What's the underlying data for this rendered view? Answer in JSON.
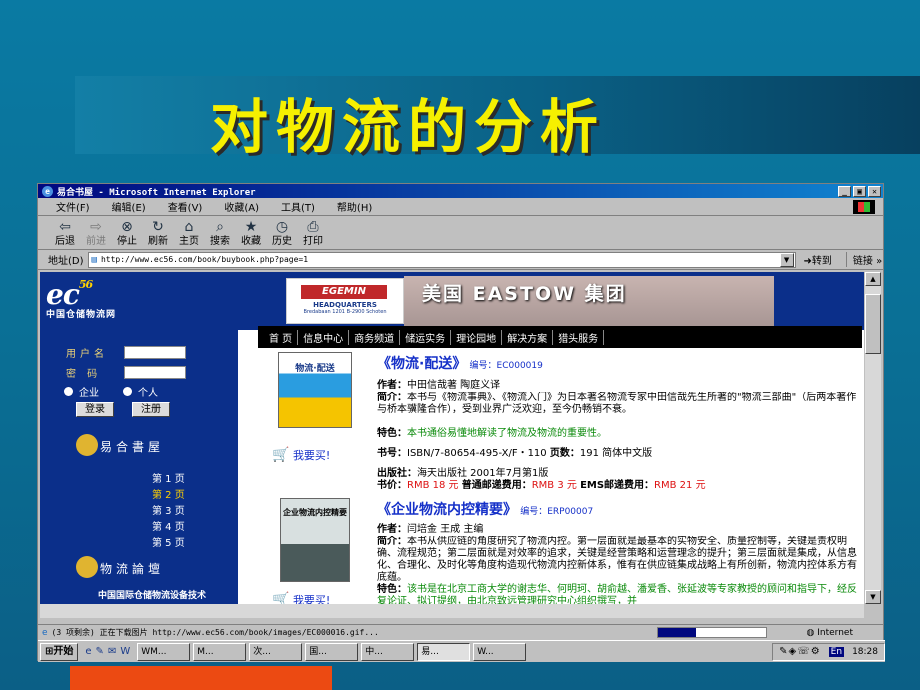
{
  "slide": {
    "title": "对物流的分析"
  },
  "browser": {
    "window_title": "易合书屋 - Microsoft Internet Explorer",
    "menu": [
      "文件(F)",
      "编辑(E)",
      "查看(V)",
      "收藏(A)",
      "工具(T)",
      "帮助(H)"
    ],
    "toolbar": [
      {
        "label": "后退",
        "icon": "back-arrow-icon",
        "enabled": true
      },
      {
        "label": "前进",
        "icon": "forward-arrow-icon",
        "enabled": false
      },
      {
        "label": "停止",
        "icon": "stop-icon",
        "enabled": true
      },
      {
        "label": "刷新",
        "icon": "refresh-icon",
        "enabled": true
      },
      {
        "label": "主页",
        "icon": "home-icon",
        "enabled": true
      },
      {
        "label": "搜索",
        "icon": "search-icon",
        "enabled": true
      },
      {
        "label": "收藏",
        "icon": "favorites-icon",
        "enabled": true
      },
      {
        "label": "历史",
        "icon": "history-icon",
        "enabled": true
      },
      {
        "label": "打印",
        "icon": "print-icon",
        "enabled": true
      }
    ],
    "address_label": "地址(D)",
    "url": "http://www.ec56.com/book/buybook.php?page=1",
    "go_label": "转到",
    "links_label": "链接",
    "status_text": "(3 项剩余) 正在下载图片 http://www.ec56.com/book/images/EC000016.gif...",
    "zone": "Internet"
  },
  "site": {
    "logo_text": "ec",
    "logo_num": "56",
    "logo_sub": "中国仓储物流网",
    "banner_company": "EGEMIN",
    "banner_hq": "HEADQUARTERS",
    "banner_addr": "Bredabaan 1201 B-2900 Schoten",
    "banner_text": "美国 EASTOW 集团",
    "nav": [
      "首 页",
      "信息中心",
      "商务频道",
      "储运实务",
      "理论园地",
      "解决方案",
      "猎头服务"
    ],
    "login": {
      "username_label": "用户名",
      "password_label": "密 码",
      "radio_business": "企业",
      "radio_person": "个人",
      "login_btn": "登录",
      "register_btn": "注册"
    },
    "section_bookstore": "易合書屋",
    "pages": [
      "第 1 页",
      "第 2 页",
      "第 3 页",
      "第 4 页",
      "第 5 页"
    ],
    "current_page_index": 1,
    "section_forum": "物流論壇",
    "footer_ad": "中国国际仓储物流设备技术"
  },
  "books": [
    {
      "title": "《物流·配送》",
      "code_label": "编号：",
      "code": "EC000019",
      "cover_title": "物流·配送",
      "author_label": "作者：",
      "author": "中田信哉著 陶庭义译",
      "intro_label": "简介：",
      "intro": "本书与《物流事典》、《物流入门》为日本著名物流专家中田信哉先生所著的\"物流三部曲\"（后两本著作与桥本骥隆合作），受到业界广泛欢迎，至今仍畅销不衰。",
      "feature_label": "特色：",
      "feature": "本书通俗易懂地解读了物流及物流的重要性。",
      "isbn_label": "书号：",
      "isbn": "ISBN/7-80654-495-X/F・110",
      "pages_label": "页数：",
      "pages": "191 简体中文版",
      "publisher_label": "出版社：",
      "publisher": "海天出版社 2001年7月第1版",
      "price_label": "书价：",
      "price": "RMB 18 元",
      "post_label": "普通邮递费用：",
      "post": "RMB 3 元",
      "ems_label": "EMS邮递费用：",
      "ems": "RMB 21 元",
      "buy_label": "我要买!"
    },
    {
      "title": "《企业物流内控精要》",
      "code_label": "编号：",
      "code": "ERP00007",
      "cover_title": "企业物流内控精要",
      "author_label": "作者：",
      "author": "闫培金 王成 主编",
      "intro_label": "简介：",
      "intro": "本书从供应链的角度研究了物流内控。第一层面就是最基本的实物安全、质量控制等，关键是责权明确、流程规范；第二层面就是对效率的追求，关键是经营策略和运营理念的提升；第三层面就是集成，从信息化、合理化、及时化等角度构造现代物流内控新体系，惟有在供应链集成战略上有所创新，物流内控体系方有底蕴。",
      "feature_label": "特色：",
      "feature": "该书是在北京工商大学的谢志华、何明珂、胡俞越、潘爱香、张延波等专家教授的顾问和指导下，经反复论证、拟订提纲，由北京致远管理研究中心组织撰写，并",
      "buy_label": "我要买!"
    }
  ],
  "taskbar": {
    "start": "开始",
    "quick_launch": [
      "e",
      "✎",
      "✉",
      "W"
    ],
    "tasks": [
      "WM...",
      "M...",
      "次...",
      "国...",
      "中...",
      "易...",
      "W..."
    ],
    "active_task_index": 5,
    "clock": "18:28",
    "lang": "En"
  },
  "colors": {
    "title": "#f6f000",
    "accent_bar": "#ec4a12",
    "site_blue": "#0b2f8a",
    "link_blue": "#1530c8",
    "price_red": "#d11111",
    "feature_green": "#0a8a0a"
  }
}
